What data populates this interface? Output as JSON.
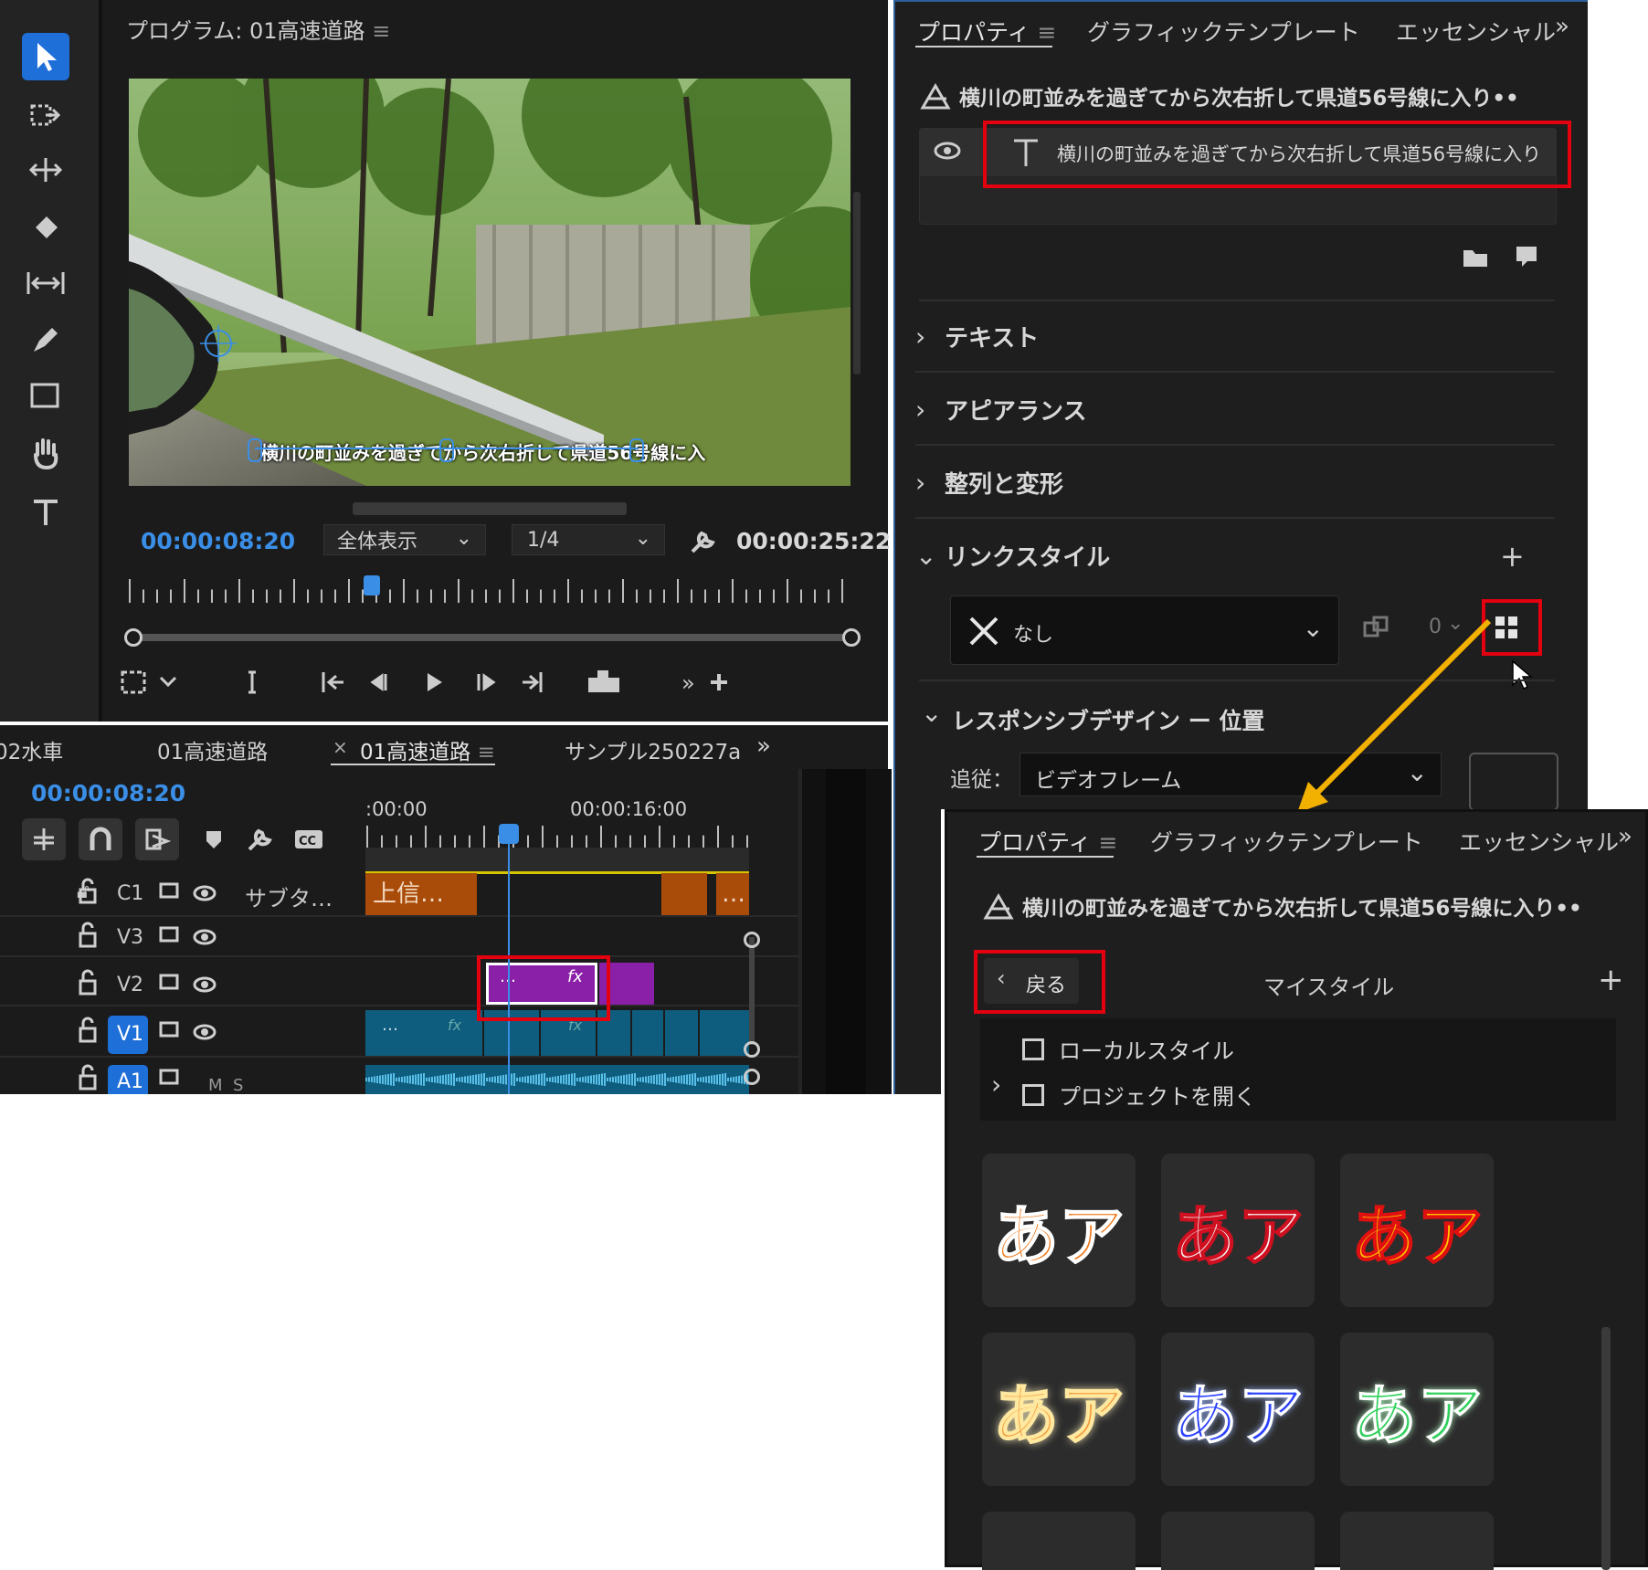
{
  "program_monitor": {
    "title": "プログラム: 01高速道路",
    "subtitle_caption": "横川の町並みを過ぎてから次右折して県道56号線に入",
    "current_timecode": "00:00:08:20",
    "zoom_select": "全体表示",
    "resolution_select": "1/4",
    "duration_timecode": "00:00:25:22"
  },
  "timeline": {
    "tabs": [
      "02水車",
      "01高速道路",
      "01高速道路",
      "サンプル250227a"
    ],
    "active_tab_close": "×",
    "timecode": "00:00:08:20",
    "ruler_labels": [
      ":00:00",
      "00:00:16:00"
    ],
    "tracks": [
      {
        "id": "C1",
        "name": "サブタ…"
      },
      {
        "id": "V3",
        "name": ""
      },
      {
        "id": "V2",
        "name": ""
      },
      {
        "id": "V1",
        "name": ""
      },
      {
        "id": "A1",
        "name": "M  S"
      }
    ],
    "clips": {
      "caption_clip": "上信…",
      "caption_clip_end": "…",
      "graphic_clip_dots": "…",
      "fx_label": "fx"
    }
  },
  "properties_top": {
    "tabs": [
      "プロパティ",
      "グラフィックテンプレート",
      "エッセンシャル"
    ],
    "more": "»",
    "clip_title": "横川の町並みを過ぎてから次右折して県道56号線に入り••",
    "layer_text": "横川の町並みを過ぎてから次右折して県道56号線に入り",
    "sections": [
      "テキスト",
      "アピアランス",
      "整列と変形",
      "リンクスタイル"
    ],
    "link_style_value": "なし",
    "link_count": "0",
    "responsive_title": "レスポンシブデザイン ー 位置",
    "follow_label": "追従：",
    "follow_value": "ビデオフレーム"
  },
  "properties_bottom": {
    "tabs": [
      "プロパティ",
      "グラフィックテンプレート",
      "エッセンシャル"
    ],
    "more": "»",
    "clip_title": "横川の町並みを過ぎてから次右折して県道56号線に入り••",
    "back_button": "戻る",
    "my_style": "マイスタイル",
    "plus": "+",
    "local_style": "ローカルスタイル",
    "open_project": "プロジェクトを開く",
    "style_tiles": [
      "あア",
      "あア",
      "あア",
      "あア",
      "あア",
      "あア"
    ],
    "colors": {
      "tile1": "#f07818",
      "tile2": "#f5f5f5",
      "tile3": "#ffd000",
      "tile4": "#f59a3a",
      "tile5": "#2a40ff",
      "tile6": "#2fd05a"
    }
  },
  "accent_colors": {
    "blue": "#3a8ee6",
    "red_highlight": "#e3000f",
    "arrow": "#f2b000",
    "purple_clip": "#8a1fa8"
  }
}
